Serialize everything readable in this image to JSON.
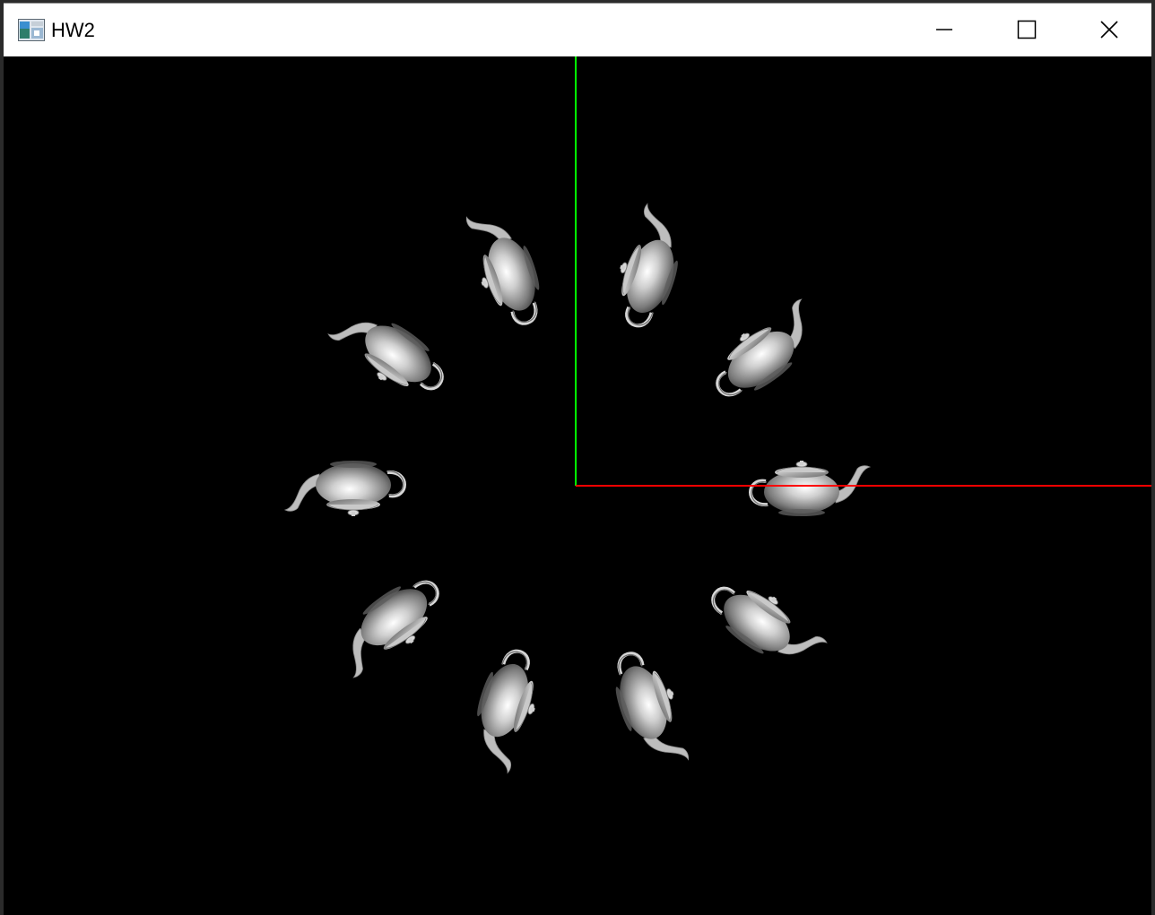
{
  "window": {
    "title": "HW2",
    "icon": "app-window-icon",
    "controls": {
      "minimize_icon": "minimize-icon",
      "maximize_icon": "maximize-icon",
      "close_icon": "close-icon"
    }
  },
  "scene": {
    "background_color": "#000000",
    "axes": {
      "x_axis_color": "#ff0000",
      "y_axis_color": "#00ff00"
    },
    "teapot_count": 10,
    "teapot_color": "#b8b8b8",
    "object": "teapot"
  }
}
